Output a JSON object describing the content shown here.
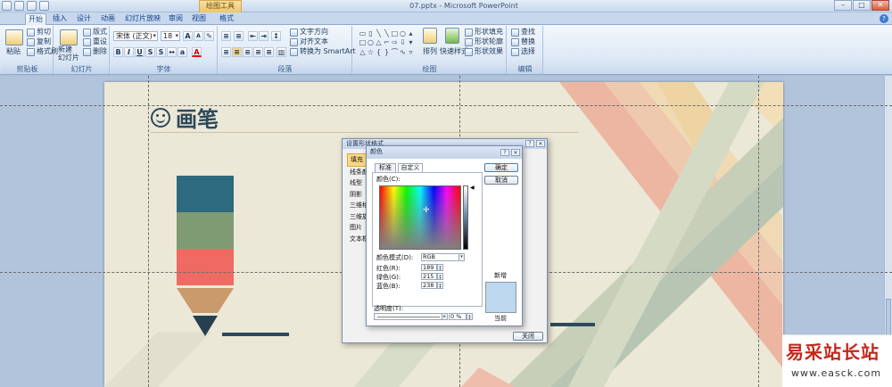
{
  "window": {
    "title": "07.pptx - Microsoft PowerPoint",
    "contextual_tab_group": "绘图工具",
    "win_buttons": [
      "–",
      "□",
      "✕"
    ]
  },
  "tabs": [
    {
      "label": "开始",
      "active": true
    },
    {
      "label": "插入"
    },
    {
      "label": "设计"
    },
    {
      "label": "动画"
    },
    {
      "label": "幻灯片放映"
    },
    {
      "label": "审阅"
    },
    {
      "label": "视图"
    },
    {
      "label": "格式"
    }
  ],
  "ribbon": {
    "clipboard": {
      "label": "剪贴板",
      "paste": "粘贴",
      "cut": "剪切",
      "copy": "复制",
      "format_painter": "格式刷"
    },
    "slides": {
      "label": "幻灯片",
      "new_slide": "新建\n幻灯片",
      "layout": "版式",
      "reset": "重设",
      "delete": "删除"
    },
    "font": {
      "label": "字体",
      "font_name": "宋体 (正文)",
      "font_size": "18",
      "bold": "B",
      "italic": "I",
      "underline": "U",
      "strike": "S",
      "grow": "A",
      "shrink": "A",
      "font_color": "A"
    },
    "paragraph": {
      "label": "段落",
      "text_direction": "文字方向",
      "align_text": "对齐文本",
      "smartart": "转换为 SmartArt"
    },
    "drawing": {
      "label": "绘图",
      "arrange": "排列",
      "quick_styles": "快速样式",
      "shape_fill": "形状填充",
      "shape_outline": "形状轮廓",
      "shape_effects": "形状效果"
    },
    "editing": {
      "label": "编辑",
      "find": "查找",
      "replace": "替换",
      "select": "选择"
    }
  },
  "slide": {
    "title": "画笔",
    "pencil_colors": [
      "#2d6a80",
      "#7f9b74",
      "#ef6a62",
      "#c99a6b",
      "#27404f"
    ]
  },
  "format_shape_dialog": {
    "title": "设置形状格式",
    "nav": [
      "填充",
      "线条颜色",
      "线型",
      "阴影",
      "三维格式",
      "三维旋转",
      "图片",
      "文本框"
    ],
    "selected_nav": "填充",
    "close_button": "关闭"
  },
  "color_dialog": {
    "title": "颜色",
    "tabs": [
      "标准",
      "自定义"
    ],
    "active_tab": "自定义",
    "colors_label": "颜色(C):",
    "color_model_label": "颜色模式(D):",
    "color_model_value": "RGB",
    "red_label": "红色(R):",
    "green_label": "绿色(G):",
    "blue_label": "蓝色(B):",
    "red": "189",
    "green": "215",
    "blue": "238",
    "transparency_label": "透明度(T):",
    "transparency_value": "0 %",
    "ok": "确定",
    "cancel": "取消",
    "new_label": "新增",
    "current_label": "当前",
    "new_color": "#bdd7ee"
  },
  "watermark": {
    "name": "易采站长站",
    "url": "www.easck.com"
  }
}
